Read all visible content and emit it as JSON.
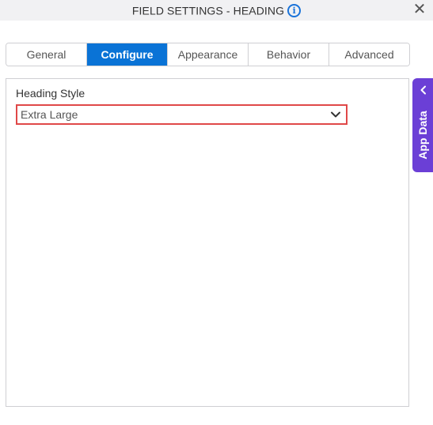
{
  "dialog": {
    "title": "FIELD SETTINGS - HEADING",
    "info_icon": "info-icon",
    "close_icon": "close-icon"
  },
  "tabs": [
    {
      "label": "General",
      "active": false
    },
    {
      "label": "Configure",
      "active": true
    },
    {
      "label": "Appearance",
      "active": false
    },
    {
      "label": "Behavior",
      "active": false
    },
    {
      "label": "Advanced",
      "active": false
    }
  ],
  "configure": {
    "heading_style_label": "Heading Style",
    "heading_style_value": "Extra Large"
  },
  "side_panel": {
    "label": "App Data",
    "icon": "chevron-left-icon"
  },
  "colors": {
    "accent": "#0a73d6",
    "app_data_bg": "#6b3fd6",
    "select_border": "#e04848"
  }
}
